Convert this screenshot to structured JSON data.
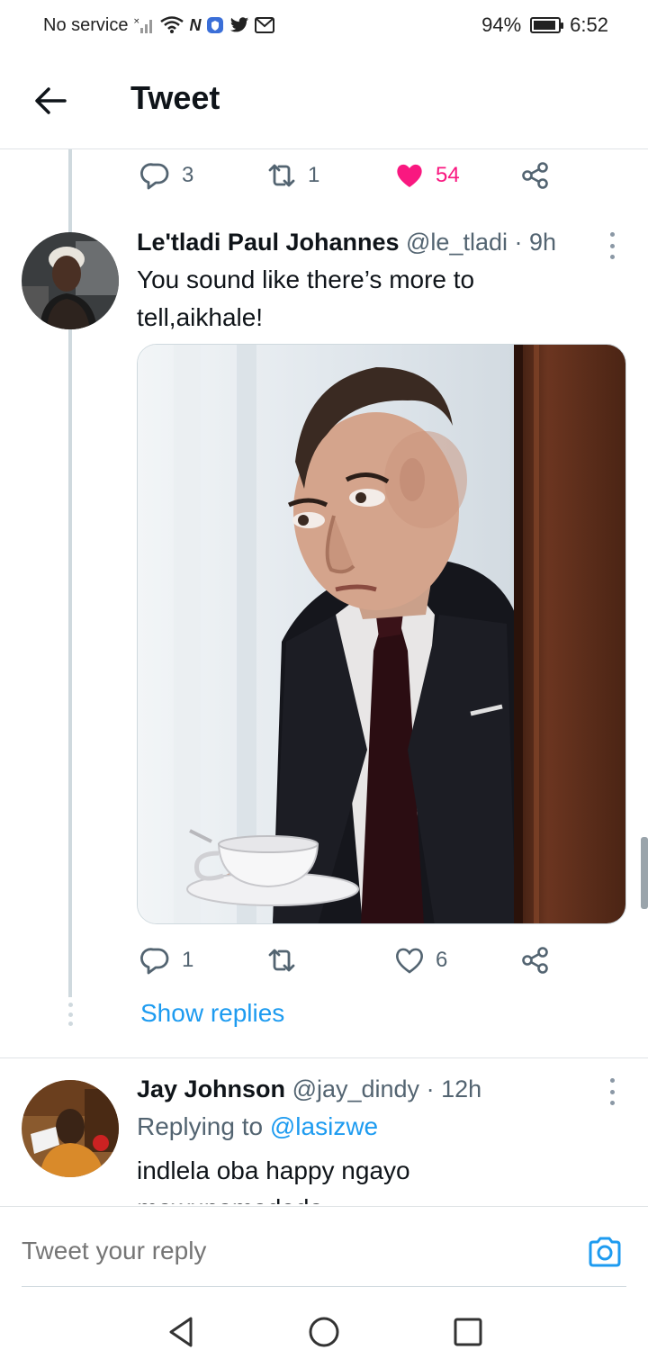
{
  "status_bar": {
    "carrier": "No service",
    "battery_percent_text": "94%",
    "battery_level": 0.94,
    "time": "6:52",
    "icons": [
      "signal-off-icon",
      "wifi-icon",
      "nfc-icon",
      "shield-app-icon",
      "twitter-app-icon",
      "gmail-icon"
    ]
  },
  "header": {
    "title": "Tweet",
    "back_icon": "arrow-left-icon"
  },
  "parent_tweet_actions": {
    "replies": "3",
    "retweets": "1",
    "likes": "54",
    "liked": true
  },
  "reply_tweet": {
    "display_name": "Le'tladi Paul Johannes",
    "handle": "@le_tladi",
    "time": "· 9h",
    "text_line1": "You sound like there’s more to",
    "text_line2": "tell,aikhale!",
    "actions": {
      "replies": "1",
      "retweets": "",
      "likes": "6"
    },
    "show_replies": "Show replies"
  },
  "second_reply": {
    "display_name": "Jay Johnson",
    "handle": "@jay_dindy",
    "time": "· 12h",
    "replying_label": "Replying to",
    "replying_handle": "@lasizwe",
    "text_line1": "indlela oba happy ngayo",
    "text_line2": "mawunamadoda"
  },
  "compose": {
    "placeholder": "Tweet your reply"
  },
  "colors": {
    "accent": "#1d9bf0",
    "like": "#f91880",
    "secondary_text": "#536471"
  }
}
